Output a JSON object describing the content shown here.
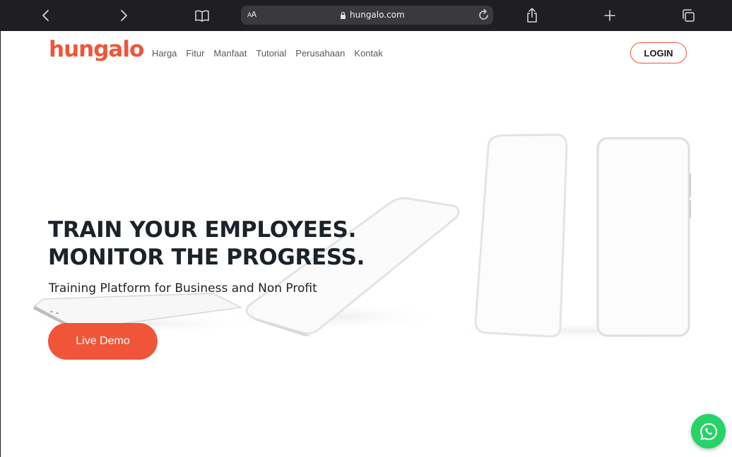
{
  "browser": {
    "url_display": "hungalo.com",
    "reader_label": "AA"
  },
  "header": {
    "logo_text": "hungalo",
    "nav": [
      "Harga",
      "Fitur",
      "Manfaat",
      "Tutorial",
      "Perusahaan",
      "Kontak"
    ],
    "login_label": "LOGIN"
  },
  "hero": {
    "headline_line1": "TRAIN YOUR EMPLOYEES.",
    "headline_line2": "MONITOR THE PROGRESS.",
    "subtitle": "Training Platform for Business and Non Profit",
    "cta_label": "Live Demo"
  },
  "colors": {
    "brand": "#f0553a",
    "toolbar": "#1f1f21",
    "whatsapp": "#25d366",
    "text_dark": "#1c2229"
  },
  "icons": [
    "back-icon",
    "forward-icon",
    "bookmarks-icon",
    "lock-icon",
    "reload-icon",
    "share-icon",
    "new-tab-icon",
    "tabs-icon",
    "whatsapp-icon"
  ]
}
